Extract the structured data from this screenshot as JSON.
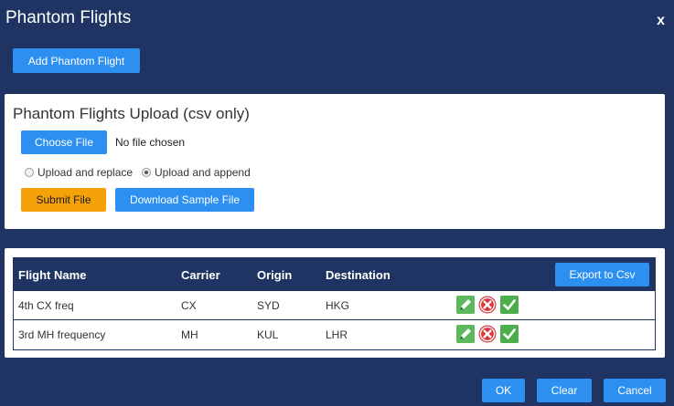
{
  "dialog": {
    "title": "Phantom Flights",
    "close_label": "x"
  },
  "toolbar": {
    "add_label": "Add Phantom Flight"
  },
  "upload": {
    "title": "Phantom Flights Upload (csv only)",
    "choose_label": "Choose File",
    "no_file_text": "No file chosen",
    "options": [
      {
        "label": "Upload and replace",
        "checked": false
      },
      {
        "label": "Upload and append",
        "checked": true
      }
    ],
    "submit_label": "Submit File",
    "download_label": "Download Sample File"
  },
  "table": {
    "headers": {
      "flight_name": "Flight Name",
      "carrier": "Carrier",
      "origin": "Origin",
      "destination": "Destination"
    },
    "export_label": "Export to Csv",
    "rows": [
      {
        "flight_name": "4th CX freq",
        "carrier": "CX",
        "origin": "SYD",
        "destination": "HKG"
      },
      {
        "flight_name": "3rd MH frequency",
        "carrier": "MH",
        "origin": "KUL",
        "destination": "LHR"
      }
    ],
    "row_actions": [
      "edit-icon",
      "delete-icon",
      "confirm-icon"
    ]
  },
  "footer": {
    "ok_label": "OK",
    "clear_label": "Clear",
    "cancel_label": "Cancel"
  },
  "colors": {
    "background": "#1f3462",
    "primary_button": "#2d8ff0",
    "submit_button": "#f5a10a",
    "edit_icon": "#5cb85c",
    "delete_icon": "#d9363e",
    "confirm_icon": "#4cae4c"
  }
}
